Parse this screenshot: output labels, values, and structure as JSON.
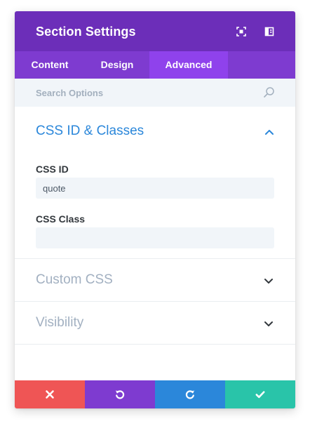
{
  "header": {
    "title": "Section Settings",
    "icons": [
      "expand-icon",
      "sidebar-layout-icon"
    ]
  },
  "tabs": [
    {
      "label": "Content",
      "active": false
    },
    {
      "label": "Design",
      "active": false
    },
    {
      "label": "Advanced",
      "active": true
    }
  ],
  "search": {
    "placeholder": "Search Options",
    "value": ""
  },
  "groups": {
    "css_id_classes": {
      "title": "CSS ID & Classes",
      "expanded": true,
      "fields": {
        "css_id": {
          "label": "CSS ID",
          "value": "quote"
        },
        "css_class": {
          "label": "CSS Class",
          "value": ""
        }
      }
    },
    "custom_css": {
      "title": "Custom CSS",
      "expanded": false
    },
    "visibility": {
      "title": "Visibility",
      "expanded": false
    }
  },
  "footer": {
    "buttons": [
      {
        "name": "cancel",
        "icon": "close-icon",
        "color": "#ef5555"
      },
      {
        "name": "undo",
        "icon": "undo-icon",
        "color": "#7e3bd0"
      },
      {
        "name": "redo",
        "icon": "redo-icon",
        "color": "#2b87da"
      },
      {
        "name": "save",
        "icon": "checkmark-icon",
        "color": "#29c4a9"
      }
    ]
  },
  "colors": {
    "header_bg": "#6c2eb9",
    "tabs_bg": "#7e3bd0",
    "active_tab_bg": "#8f42ec",
    "accent_blue": "#2b87da",
    "muted_title": "#a2b0c1",
    "field_bg": "#f1f5f9"
  }
}
